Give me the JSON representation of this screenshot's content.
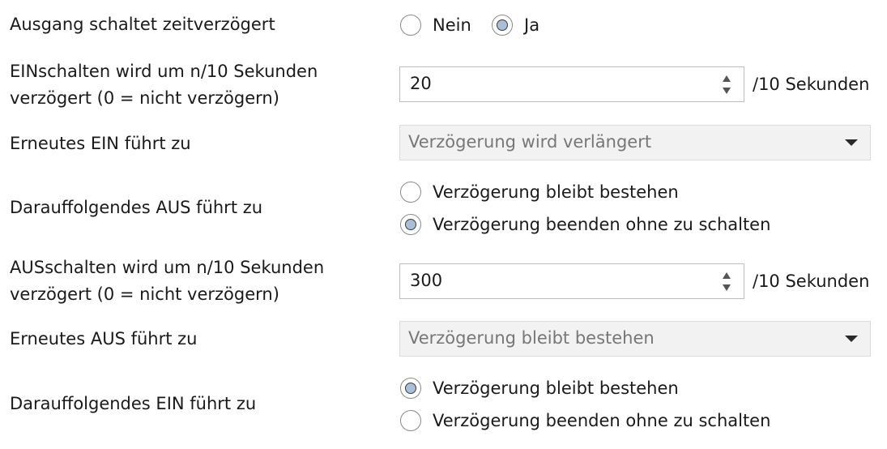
{
  "rows": {
    "delayed": {
      "label": "Ausgang schaltet zeitverzögert",
      "options": [
        "Nein",
        "Ja"
      ],
      "selected": "Ja"
    },
    "on_delay": {
      "label_line1": "EINschalten wird um n/10 Sekunden",
      "label_line2": "verzögert (0 = nicht verzögern)",
      "value": "20",
      "unit": "/10 Sekunden"
    },
    "repeat_on": {
      "label": "Erneutes EIN führt zu",
      "value": "Verzögerung wird verlängert"
    },
    "following_off": {
      "label": "Darauffolgendes AUS führt zu",
      "options": [
        "Verzögerung bleibt bestehen",
        "Verzögerung beenden ohne zu schalten"
      ],
      "selected": "Verzögerung beenden ohne zu schalten"
    },
    "off_delay": {
      "label_line1": "AUSschalten wird um n/10 Sekunden",
      "label_line2": "verzögert (0 = nicht verzögern)",
      "value": "300",
      "unit": "/10 Sekunden"
    },
    "repeat_off": {
      "label": "Erneutes AUS führt zu",
      "value": "Verzögerung bleibt bestehen"
    },
    "following_on": {
      "label": "Darauffolgendes EIN führt zu",
      "options": [
        "Verzögerung bleibt bestehen",
        "Verzögerung beenden ohne zu schalten"
      ],
      "selected": "Verzögerung bleibt bestehen"
    }
  },
  "colors": {
    "radio_dot": "#a9bfd8",
    "disabled_bg": "#f2f2f2"
  }
}
